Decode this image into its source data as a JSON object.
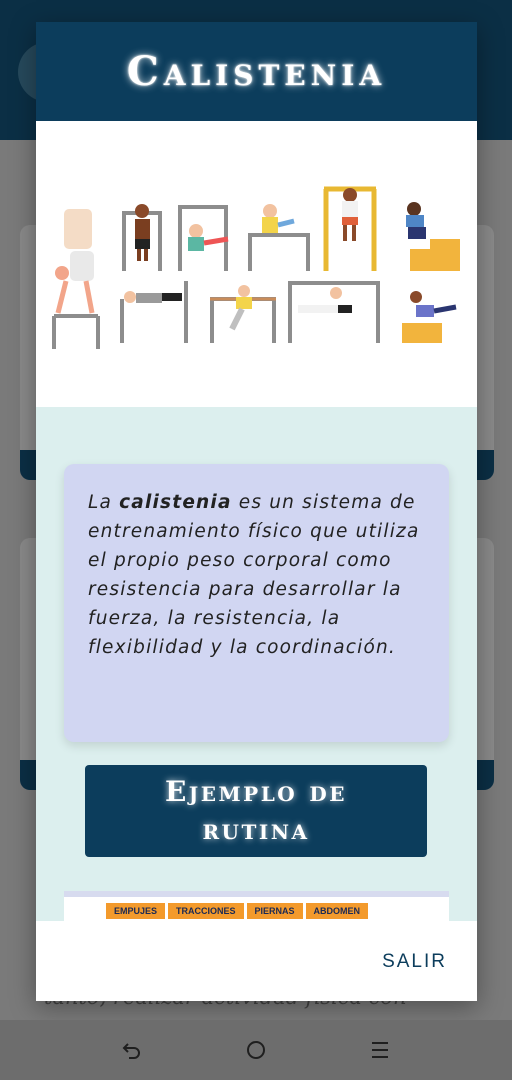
{
  "dialog": {
    "title": "Calistenia",
    "description_prefix": "La ",
    "description_bold": "calistenia",
    "description_rest": " es un sistema de entrenamiento físico que utiliza el propio peso corporal como resistencia para desarrollar la fuerza, la resistencia, la flexibilidad y la coordinación.",
    "routine_button": "Ejemplo de rutina",
    "routine_tabs": [
      "EMPUJES",
      "TRACCIONES",
      "PIERNAS",
      "ABDOMEN"
    ],
    "exit_button": "SALIR",
    "illustration": "calisthenics-athletes-illustration"
  },
  "background": {
    "partial_text": "tanto, realizar actividad física con"
  },
  "navigation": {
    "icons": [
      "back-icon",
      "home-icon",
      "recents-icon"
    ]
  },
  "colors": {
    "primary": "#0c3d5c",
    "card": "#d1d6f2",
    "content_bg": "#dcefee",
    "tab_orange": "#f39a2c"
  }
}
